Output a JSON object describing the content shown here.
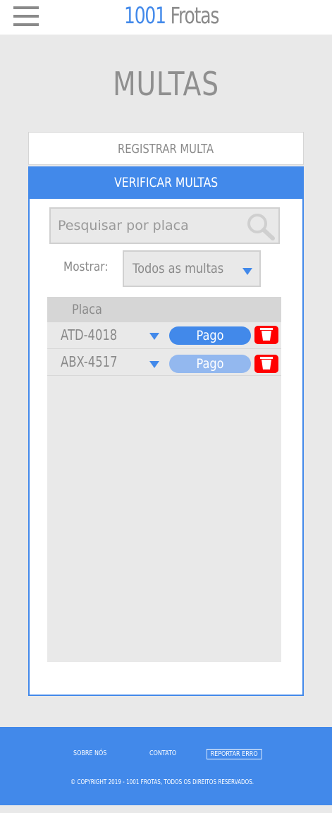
{
  "header": {
    "logo_number": "1001",
    "logo_word": "Frotas"
  },
  "page": {
    "title": "MULTAS"
  },
  "tabs": {
    "register": "REGISTRAR MULTA",
    "verify": "VERIFICAR MULTAS"
  },
  "search": {
    "placeholder": "Pesquisar por placa",
    "value": ""
  },
  "filter": {
    "label": "Mostrar:",
    "selected": "Todos as multas"
  },
  "table": {
    "column_header": "Placa",
    "rows": [
      {
        "plate": "ATD-4018",
        "status": "Pago",
        "status_color": "#4289ea"
      },
      {
        "plate": "ABX-4517",
        "status": "Pago",
        "status_color": "#93b8ef"
      }
    ]
  },
  "footer": {
    "about": "SOBRE NÓS",
    "contact": "CONTATO",
    "report": "REPORTAR ERRO",
    "copyright": "© COPYRIGHT 2019 - 1001 FROTAS, TODOS OS DIREITOS RESERVADOS."
  },
  "colors": {
    "accent": "#4289ea",
    "delete": "#ff0000",
    "background": "#e9e9e9"
  },
  "icons": [
    "menu-icon",
    "search-icon",
    "chevron-down-icon",
    "trash-icon"
  ]
}
